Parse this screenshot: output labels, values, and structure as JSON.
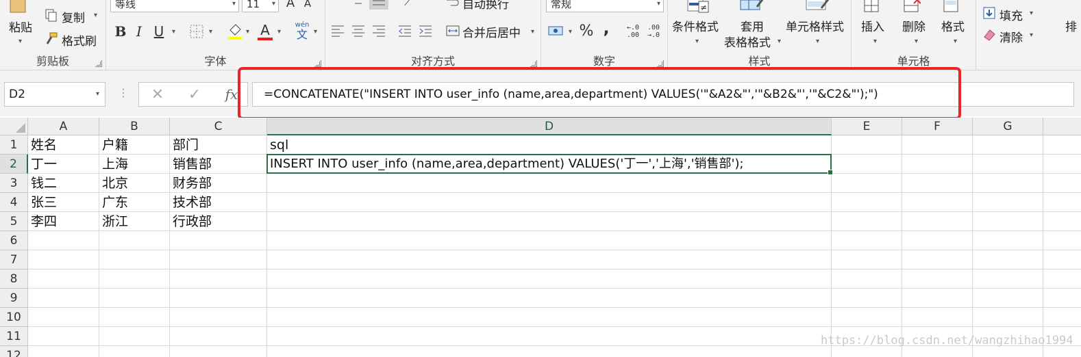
{
  "ribbon": {
    "clipboard": {
      "label": "剪贴板",
      "paste": "粘贴",
      "copy": "复制",
      "format_painter": "格式刷"
    },
    "font": {
      "label": "字体",
      "font_name": "等线",
      "font_size": "11",
      "bold": "B",
      "italic": "I",
      "underline": "U",
      "font_color": "A",
      "phonetic_top": "wén",
      "phonetic_bottom": "文"
    },
    "alignment": {
      "label": "对齐方式",
      "wrap_text": "自动换行",
      "merge_center": "合并后居中"
    },
    "number": {
      "label": "数字",
      "format": "常规",
      "percent": "%",
      "comma": ","
    },
    "styles": {
      "label": "样式",
      "conditional": "条件格式",
      "table_line1": "套用",
      "table_line2": "表格格式",
      "cell_styles": "单元格样式"
    },
    "cells": {
      "label": "单元格",
      "insert": "插入",
      "delete": "删除",
      "format": "格式"
    },
    "editing": {
      "fill": "填充",
      "clear": "清除",
      "sort_partial": "排"
    }
  },
  "formula_bar": {
    "name_box": "D2",
    "fx": "fx",
    "formula": "=CONCATENATE(\"INSERT INTO user_info (name,area,department) VALUES('\"&A2&\"','\"&B2&\"','\"&C2&\"');\")"
  },
  "sheet": {
    "columns": [
      "A",
      "B",
      "C",
      "D",
      "E",
      "F",
      "G"
    ],
    "rows": [
      "1",
      "2",
      "3",
      "4",
      "5",
      "6",
      "7",
      "8",
      "9",
      "10",
      "11",
      "12"
    ],
    "cells": {
      "A1": "姓名",
      "B1": "户籍",
      "C1": "部门",
      "D1": "sql",
      "A2": "丁一",
      "B2": "上海",
      "C2": "销售部",
      "D2": "INSERT INTO user_info (name,area,department) VALUES('丁一','上海','销售部');",
      "A3": "钱二",
      "B3": "北京",
      "C3": "财务部",
      "A4": "张三",
      "B4": "广东",
      "C4": "技术部",
      "A5": "李四",
      "B5": "浙江",
      "C5": "行政部"
    },
    "selected_cell": "D2"
  },
  "watermark": "https://blog.csdn.net/wangzhihao1994",
  "colors": {
    "excel_green": "#217346",
    "highlight_red": "#e8262a",
    "font_color_bar": "#e81c1c"
  }
}
